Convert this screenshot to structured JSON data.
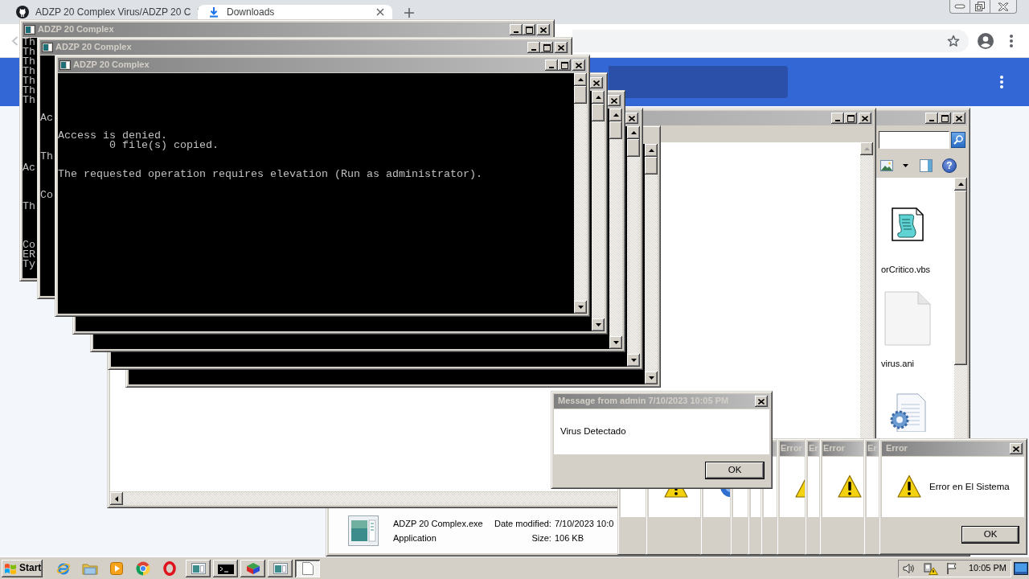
{
  "browser": {
    "tabs": [
      {
        "kind": "repo",
        "title": "ADZP 20 Complex Virus/ADZP 20 C",
        "selected": false
      },
      {
        "kind": "downloads",
        "title": "Downloads",
        "selected": true
      }
    ]
  },
  "consoles": [
    {
      "title": "ADZP 20 Complex",
      "lines": [
        "Th",
        "Th",
        "Th",
        "Th",
        "Th",
        "Th",
        "Th",
        "Ac",
        "Th",
        "Co",
        "ER",
        "Ty"
      ]
    },
    {
      "title": "ADZP 20 Complex",
      "lines": [
        "Ac",
        "Th",
        "Co"
      ]
    },
    {
      "title": "ADZP 20 Complex",
      "lines": [
        "Access is denied.",
        "        0 file(s) copied.",
        "The requested operation requires elevation (Run as administrator)."
      ]
    }
  ],
  "explorer": {
    "help": "?",
    "files": [
      {
        "kind": "script",
        "name": "orCritico.vbs"
      },
      {
        "kind": "blank",
        "name": "virus.ani"
      },
      {
        "kind": "settings"
      }
    ],
    "details": {
      "name": "ADZP 20 Complex.exe",
      "type": "Application",
      "fields": [
        {
          "label": "Date modified:",
          "value": "7/10/2023 10:0"
        },
        {
          "label": "Size:",
          "value": "106 KB"
        }
      ]
    }
  },
  "error_dialogs": [
    {
      "title": "Error"
    },
    {
      "title": "Er"
    },
    {
      "title": "Error"
    },
    {
      "title": "Er"
    },
    {
      "title": "Error",
      "message": "Error en El Sistema",
      "button": "OK"
    }
  ],
  "message_box": {
    "title": "Message from admin 7/10/2023 10:05 PM",
    "message": "Virus Detectado",
    "button": "OK"
  },
  "taskbar": {
    "start": "Start",
    "tasks": [
      {
        "kind": "console",
        "selected": false
      },
      {
        "kind": "terminal",
        "selected": false
      },
      {
        "kind": "cube",
        "selected": false
      },
      {
        "kind": "window",
        "selected": false
      },
      {
        "kind": "document",
        "selected": true
      }
    ],
    "clock": "10:05 PM"
  }
}
